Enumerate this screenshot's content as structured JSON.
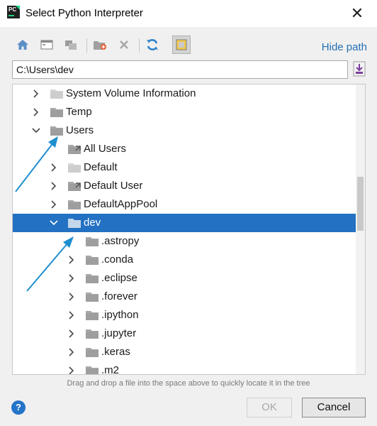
{
  "window": {
    "title": "Select Python Interpreter",
    "app_icon_text": "PC",
    "close_glyph": "✕"
  },
  "toolbar": {
    "buttons": [
      "home-icon",
      "desktop-icon",
      "project-icon",
      "new-folder-icon",
      "delete-icon",
      "refresh-icon",
      "show-hidden-icon"
    ],
    "active_button": "show-hidden-icon",
    "hide_path_label": "Hide path"
  },
  "path": {
    "value": "C:\\Users\\dev"
  },
  "tree": {
    "items": [
      {
        "label": "System Volume Information",
        "level": 1,
        "expander": "collapsed",
        "folder": "faded"
      },
      {
        "label": "Temp",
        "level": 1,
        "expander": "collapsed",
        "folder": "normal"
      },
      {
        "label": "Users",
        "level": 1,
        "expander": "expanded",
        "folder": "normal"
      },
      {
        "label": "All Users",
        "level": 2,
        "expander": "none",
        "folder": "link"
      },
      {
        "label": "Default",
        "level": 2,
        "expander": "collapsed",
        "folder": "faded"
      },
      {
        "label": "Default User",
        "level": 2,
        "expander": "collapsed",
        "folder": "link"
      },
      {
        "label": "DefaultAppPool",
        "level": 2,
        "expander": "collapsed",
        "folder": "normal"
      },
      {
        "label": "dev",
        "level": 2,
        "expander": "expanded",
        "folder": "normal",
        "selected": true
      },
      {
        "label": ".astropy",
        "level": 3,
        "expander": "none",
        "folder": "normal"
      },
      {
        "label": ".conda",
        "level": 3,
        "expander": "collapsed",
        "folder": "normal"
      },
      {
        "label": ".eclipse",
        "level": 3,
        "expander": "collapsed",
        "folder": "normal"
      },
      {
        "label": ".forever",
        "level": 3,
        "expander": "collapsed",
        "folder": "normal"
      },
      {
        "label": ".ipython",
        "level": 3,
        "expander": "collapsed",
        "folder": "normal"
      },
      {
        "label": ".jupyter",
        "level": 3,
        "expander": "collapsed",
        "folder": "normal"
      },
      {
        "label": ".keras",
        "level": 3,
        "expander": "collapsed",
        "folder": "normal"
      },
      {
        "label": ".m2",
        "level": 3,
        "expander": "collapsed",
        "folder": "normal"
      }
    ]
  },
  "hint": "Drag and drop a file into the space above to quickly locate it in the tree",
  "buttons": {
    "help": "?",
    "ok": "OK",
    "cancel": "Cancel"
  },
  "colors": {
    "selection": "#2371c2",
    "link": "#2470b3",
    "annotation_arrow": "#1e8fd0",
    "folder": "#999999"
  }
}
